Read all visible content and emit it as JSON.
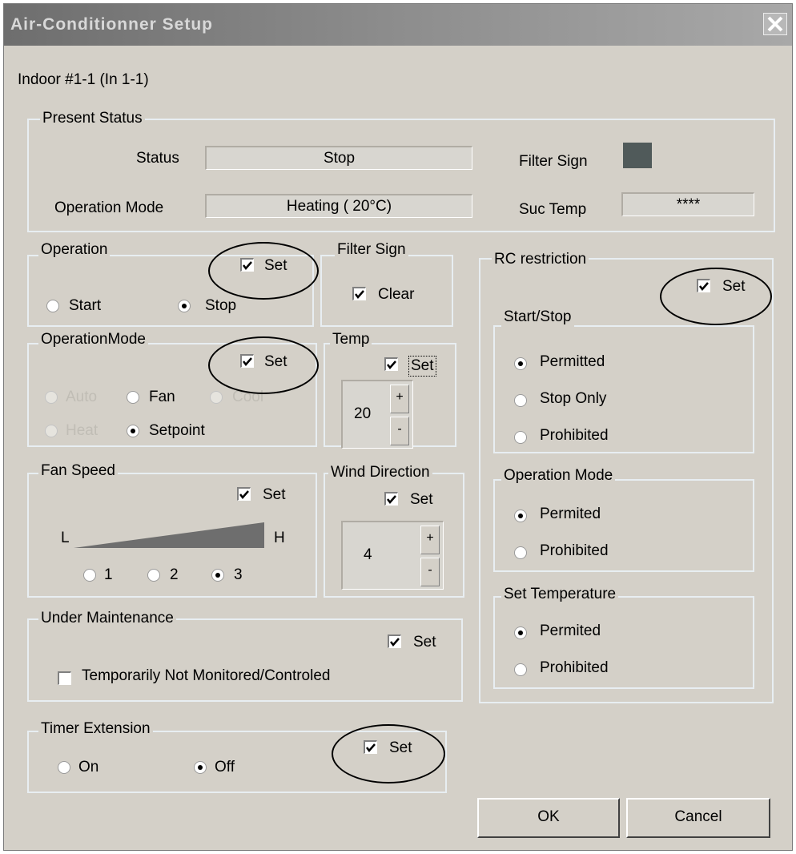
{
  "window": {
    "title": "Air-Conditionner Setup",
    "close_icon": "close-icon"
  },
  "unit_label": "Indoor #1-1  (In 1-1)",
  "present_status": {
    "legend": "Present Status",
    "status_label": "Status",
    "status_value": "Stop",
    "mode_label": "Operation Mode",
    "mode_value": "Heating  ( 20°C)",
    "filter_label": "Filter Sign",
    "suc_label": "Suc Temp",
    "suc_value": "****"
  },
  "operation": {
    "legend": "Operation",
    "set_label": "Set",
    "set_checked": true,
    "start_label": "Start",
    "stop_label": "Stop",
    "selected": "Stop"
  },
  "filter_sign": {
    "legend": "Filter Sign",
    "clear_label": "Clear",
    "clear_checked": true
  },
  "operation_mode": {
    "legend": "OperationMode",
    "set_label": "Set",
    "set_checked": true,
    "auto_label": "Auto",
    "fan_label": "Fan",
    "cool_label": "Cool",
    "heat_label": "Heat",
    "setpoint_label": "Setpoint",
    "selected": "Setpoint"
  },
  "temp": {
    "legend": "Temp",
    "set_label": "Set",
    "set_checked": true,
    "value": "20",
    "plus": "+",
    "minus": "-"
  },
  "fan_speed": {
    "legend": "Fan Speed",
    "set_label": "Set",
    "set_checked": true,
    "low": "L",
    "high": "H",
    "options": [
      "1",
      "2",
      "3"
    ],
    "selected": "3"
  },
  "wind_direction": {
    "legend": "Wind Direction",
    "set_label": "Set",
    "set_checked": true,
    "value": "4",
    "plus": "+",
    "minus": "-"
  },
  "under_maintenance": {
    "legend": "Under Maintenance",
    "set_label": "Set",
    "set_checked": true,
    "not_monitored_label": "Temporarily Not Monitored/Controled",
    "not_monitored_checked": false
  },
  "timer_extension": {
    "legend": "Timer Extension",
    "set_label": "Set",
    "set_checked": true,
    "on_label": "On",
    "off_label": "Off",
    "selected": "Off"
  },
  "rc_restriction": {
    "legend": "RC restriction",
    "set_label": "Set",
    "set_checked": true,
    "start_stop": {
      "legend": "Start/Stop",
      "permitted": "Permitted",
      "stop_only": "Stop Only",
      "prohibited": "Prohibited",
      "selected": "Permitted"
    },
    "operation_mode": {
      "legend": "Operation Mode",
      "permitted": "Permited",
      "prohibited": "Prohibited",
      "selected": "Permited"
    },
    "set_temperature": {
      "legend": "Set Temperature",
      "permitted": "Permited",
      "prohibited": "Prohibited",
      "selected": "Permited"
    }
  },
  "buttons": {
    "ok": "OK",
    "cancel": "Cancel"
  },
  "colors": {
    "titlebar": "#8d8d8d",
    "dialog_bg": "#d4d0c8",
    "filter_sign_indicator": "#505a5a"
  }
}
